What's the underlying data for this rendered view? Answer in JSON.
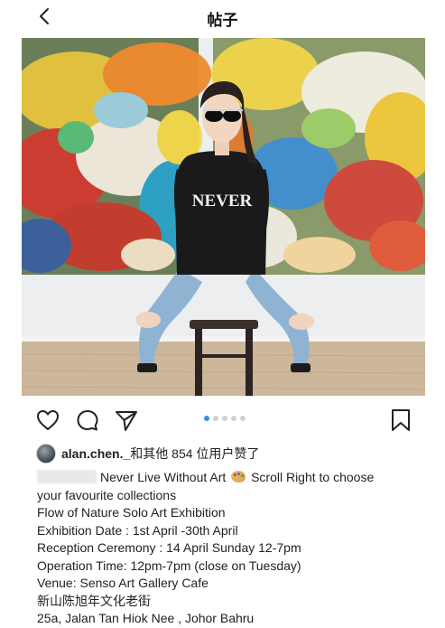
{
  "header": {
    "title": "帖子"
  },
  "post": {
    "shirt_text": "NEVER",
    "carousel_count": 5,
    "carousel_active": 1,
    "likes": {
      "user": "alan.chen._",
      "suffix": "和其他 854 位用户赞了"
    },
    "caption": {
      "first_line": "Never Live Without Art",
      "first_line_after_emoji": "Scroll Right to choose",
      "lines": [
        "your favourite collections",
        "Flow of Nature Solo Art Exhibition",
        "Exhibition Date : 1st April -30th April",
        "Reception Ceremony : 14 April Sunday 12-7pm",
        "Operation Time: 12pm-7pm (close on Tuesday)",
        "Venue: Senso Art Gallery Cafe",
        "新山陈旭年文化老街",
        "25a, Jalan Tan Hiok Nee , Johor Bahru"
      ]
    }
  },
  "icons": {
    "back": "chevron-left-icon",
    "like": "heart-icon",
    "comment": "comment-bubble-icon",
    "share": "send-icon",
    "save": "bookmark-icon",
    "caption_emoji": "artist-palette-icon"
  },
  "colors": {
    "accent_dot": "#3b8de0",
    "inactive_dot": "#cfcfcf"
  }
}
